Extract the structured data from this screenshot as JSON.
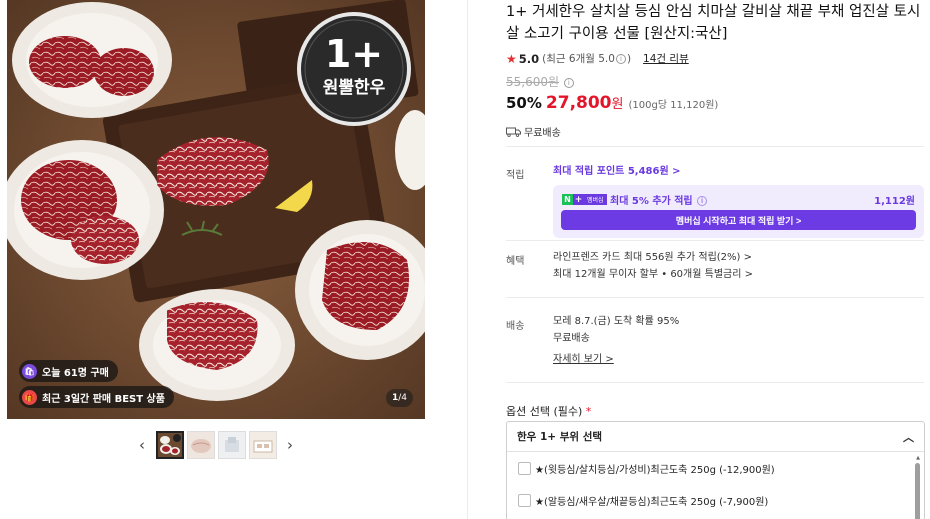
{
  "gallery": {
    "hero_badge_line1": "1+",
    "hero_badge_line2": "원뿔한우",
    "badge_buyers": "오늘 61명 구매",
    "badge_best": "최근 3일간 판매 BEST 상품",
    "counter_current": "1",
    "counter_total": "/4",
    "prev_arrow": "‹",
    "next_arrow": "›",
    "thumbnails": 4,
    "active_thumbnail": 1
  },
  "product": {
    "title": "1+ 거세한우 살치살 등심 안심 치마살 갈비살 채끝 부채 업진살 토시살 소고기 구이용 선물 [원산지:국산]",
    "rating_star": "★",
    "rating_score": "5.0",
    "rating_recent": "(최근 6개월 5.0",
    "rating_recent_close": ")",
    "review_count": "14건 리뷰",
    "original_price": "55,600원",
    "discount_rate": "50%",
    "sale_price": "27,800",
    "sale_unit": "원",
    "unit_price": "(100g당 11,120원)",
    "shipping": "무료배송"
  },
  "points": {
    "label": "적립",
    "max_points": "최대 적립 포인트 5,486원 >",
    "n_badge": "N",
    "plus_badge": "+",
    "membership_badge": "멤버십",
    "extra_rate": "최대 5% 추가 적립",
    "extra_amount": "1,112원",
    "join_button": "멤버십 시작하고 최대 적립 받기 >"
  },
  "benefits": {
    "label": "혜택",
    "line1": "라인프렌즈 카드 최대 556원 추가 적립(2%) >",
    "line2": "최대 12개월 무이자 할부 • 60개월 특별금리 >"
  },
  "delivery": {
    "label": "배송",
    "arrival": "모레 8.7.(금) 도착 확률 95%",
    "fee": "무료배송",
    "detail_link": "자세히 보기 >"
  },
  "options": {
    "label": "옵션 선택 (필수)",
    "required_mark": "*",
    "group_title": "한우 1+ 부위 선택",
    "collapse_icon": "︿",
    "items": [
      "★(윗등심/살치등심/가성비)최근도축 250g (-12,900원)",
      "★(알등심/새우살/채끝등심)최근도축 250g (-7,900원)"
    ]
  },
  "colors": {
    "accent_red": "#e4152a",
    "membership_purple": "#6c3be3",
    "naver_green": "#18c257"
  }
}
